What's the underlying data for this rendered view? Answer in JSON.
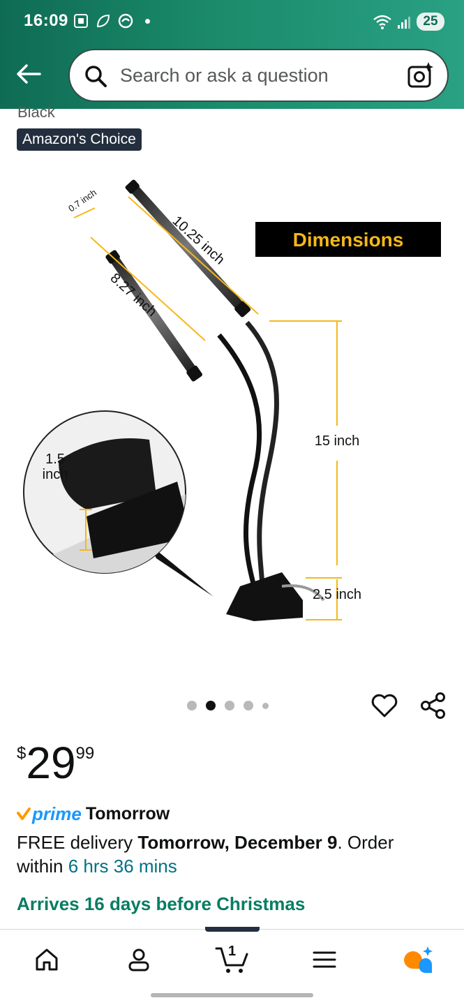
{
  "status_bar": {
    "time": "16:09",
    "battery": "25"
  },
  "search": {
    "placeholder": "Search or ask a question"
  },
  "product": {
    "variant": "Black",
    "badge": "Amazon's Choice",
    "image_labels": {
      "banner": "Dimensions",
      "dim1": "0.7 inch",
      "dim2": "10.25 inch",
      "dim3": "8.27 inch",
      "dim4": "15 inch",
      "dim5": "1.5",
      "dim5b": "inch",
      "dim6": "2.5 inch"
    },
    "carousel": {
      "total": 5,
      "active_index": 1
    }
  },
  "price": {
    "symbol": "$",
    "whole": "29",
    "fraction": "99"
  },
  "delivery": {
    "prime_logo": "prime",
    "prime_day": "Tomorrow",
    "free_prefix": "FREE delivery ",
    "date": "Tomorrow, December 9",
    "order_within": ". Order within ",
    "countdown": "6 hrs 36 mins",
    "christmas": "Arrives 16 days before Christmas"
  },
  "nav": {
    "cart_count": "1"
  },
  "colors": {
    "header_start": "#0f6b54",
    "header_end": "#2aa184",
    "badge": "#232f3e",
    "dimension_accent": "#f5b819",
    "link": "#007185",
    "christmas_green": "#067d62",
    "prime_blue": "#1a98ff",
    "prime_check": "#ff9900"
  },
  "icons": {
    "back": "arrow-left-icon",
    "search": "search-icon",
    "camera": "camera-lens-icon",
    "wishlist": "heart-icon",
    "share": "share-icon",
    "home": "home-icon",
    "account": "person-icon",
    "cart": "cart-icon",
    "menu": "menu-icon",
    "rufus": "rufus-ai-icon"
  }
}
